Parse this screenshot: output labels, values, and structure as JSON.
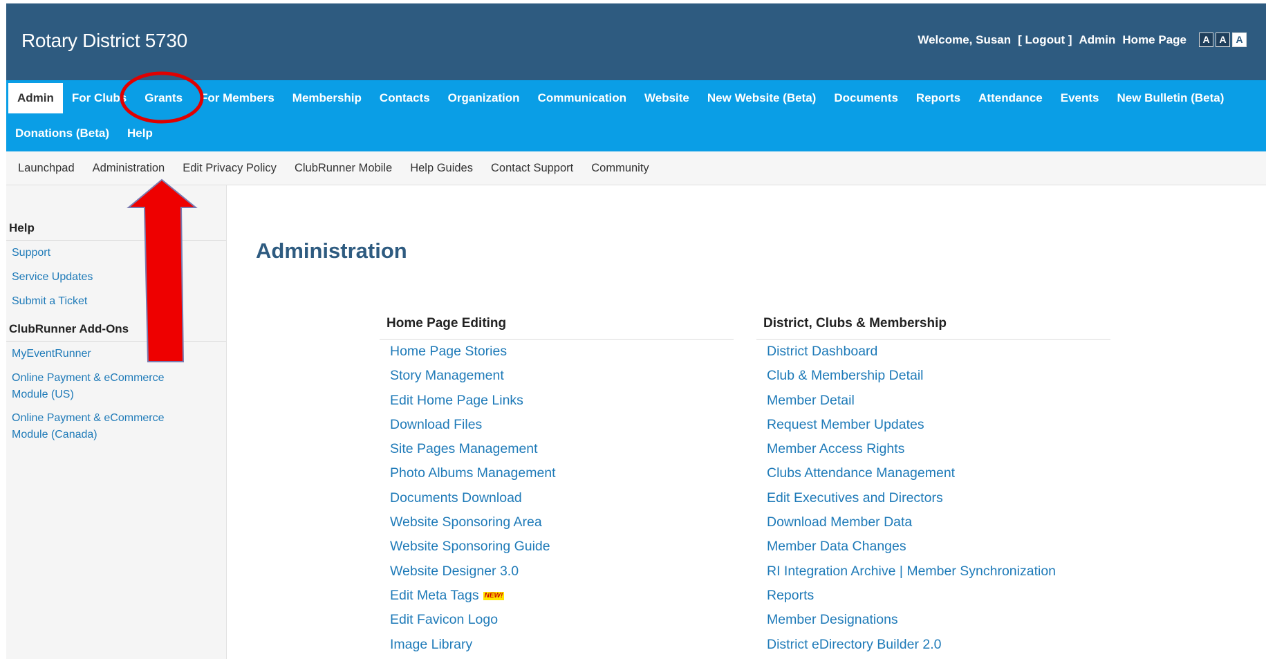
{
  "header": {
    "site_title": "Rotary District 5730",
    "welcome": "Welcome, Susan",
    "logout": "[ Logout ]",
    "admin": "Admin",
    "home_page": "Home Page",
    "font_size_icons": [
      "A",
      "A",
      "A"
    ]
  },
  "main_nav": {
    "row1": [
      "Admin",
      "For Clubs",
      "Grants",
      "For Members",
      "Membership",
      "Contacts",
      "Organization",
      "Communication",
      "Website",
      "New Website (Beta)",
      "Documents",
      "Reports",
      "Attendance",
      "Events",
      "New Bulletin (Beta)"
    ],
    "row2": [
      "Donations (Beta)",
      "Help"
    ],
    "active": "Admin"
  },
  "sub_nav": [
    "Launchpad",
    "Administration",
    "Edit Privacy Policy",
    "ClubRunner Mobile",
    "Help Guides",
    "Contact Support",
    "Community"
  ],
  "sidebar": {
    "help_heading": "Help",
    "help_links": [
      "Support",
      "Service Updates",
      "Submit a Ticket"
    ],
    "addons_heading": "ClubRunner Add-Ons",
    "addon_links": [
      "MyEventRunner",
      "Online Payment & eCommerce Module (US)",
      "Online Payment & eCommerce Module (Canada)"
    ]
  },
  "main": {
    "title": "Administration",
    "col1": {
      "heading": "Home Page Editing",
      "links": [
        "Home Page Stories",
        "Story Management",
        "Edit Home Page Links",
        "Download Files",
        "Site Pages Management",
        "Photo Albums Management",
        "Documents Download",
        "Website Sponsoring Area",
        "Website Sponsoring Guide",
        "Website Designer 3.0",
        "Edit Meta Tags",
        "Edit Favicon Logo",
        "Image Library"
      ],
      "new_badge": "NEW!"
    },
    "col2": {
      "heading": "District, Clubs & Membership",
      "links": [
        "District Dashboard",
        "Club & Membership Detail",
        "Member Detail",
        "Request Member Updates",
        "Member Access Rights",
        "Clubs Attendance Management",
        "Edit Executives and Directors",
        "Download Member Data",
        "Member Data Changes",
        "RI Integration Archive | Member Synchronization",
        "Reports",
        "Member Designations",
        "District eDirectory Builder 2.0"
      ]
    }
  },
  "colors": {
    "header_bg": "#2e5b80",
    "nav_bg": "#0a9ee6",
    "link": "#1e7ab8",
    "annotation": "#e00000"
  }
}
